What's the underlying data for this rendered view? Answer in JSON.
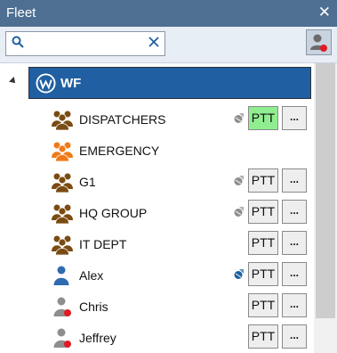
{
  "window": {
    "title": "Fleet",
    "close_label": "✕"
  },
  "search": {
    "value": "",
    "placeholder": ""
  },
  "tree": {
    "root_label": "WF",
    "items": [
      {
        "label": "DISPATCHERS",
        "icon": "group-icon",
        "color": "#7a4b12",
        "status": true,
        "ptt": "PTT",
        "ptt_active": true,
        "more": "..."
      },
      {
        "label": "EMERGENCY",
        "icon": "group-icon",
        "color": "#f07a18",
        "status": false,
        "ptt": "",
        "ptt_active": false,
        "more": ""
      },
      {
        "label": "G1",
        "icon": "group-icon",
        "color": "#7a4b12",
        "status": true,
        "ptt": "PTT",
        "ptt_active": false,
        "more": "..."
      },
      {
        "label": "HQ GROUP",
        "icon": "group-icon",
        "color": "#7a4b12",
        "status": true,
        "ptt": "PTT",
        "ptt_active": false,
        "more": "..."
      },
      {
        "label": "IT DEPT",
        "icon": "group-icon",
        "color": "#7a4b12",
        "status": false,
        "ptt": "PTT",
        "ptt_active": false,
        "more": "..."
      },
      {
        "label": "Alex",
        "icon": "user-icon",
        "color": "#2e6bb0",
        "status": true,
        "status_color": "#1f5fa2",
        "ptt": "PTT",
        "ptt_active": false,
        "more": "..."
      },
      {
        "label": "Chris",
        "icon": "user-offline-icon",
        "color": "#8e8e8e",
        "status": false,
        "ptt": "PTT",
        "ptt_active": false,
        "more": "..."
      },
      {
        "label": "Jeffrey",
        "icon": "user-offline-icon",
        "color": "#8e8e8e",
        "status": false,
        "ptt": "PTT",
        "ptt_active": false,
        "more": "..."
      }
    ]
  },
  "colors": {
    "titlebar": "#4e6f92",
    "root_bg": "#1f5fa2",
    "ptt_active": "#90ee90",
    "offline_dot": "#e01b24"
  }
}
